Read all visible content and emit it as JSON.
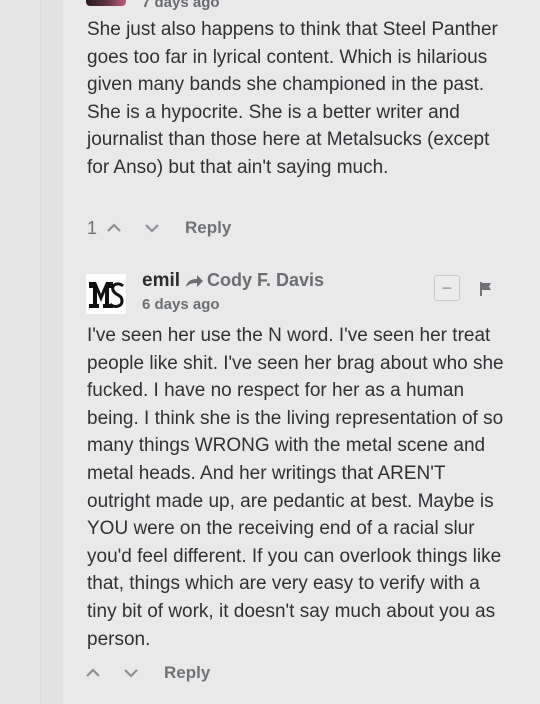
{
  "parent_comment": {
    "timestamp": "7 days ago",
    "text": "She just also happens to think that Steel Panther goes too far in lyrical content. Which is hilarious given many bands she championed in the past. She is a hypocrite. She is a better writer and journalist than those here at Metalsucks (except for Anso) but that ain't saying much.",
    "upvotes": "1",
    "reply_label": "Reply"
  },
  "reply_comment": {
    "author": "emil",
    "reply_to": "Cody F. Davis",
    "timestamp": "6 days ago",
    "collapse_label": "−",
    "text": "I've seen her use the N word. I've seen her treat people like shit. I've seen her brag about who she fucked. I have no respect for her as a human being. I think she is the living representation of so many things WRONG with the metal scene and metal heads. And her writings that AREN'T outright made up, are pedantic at best. Maybe is YOU were on the receiving end of a racial slur you'd feel different. If you can overlook things like that, things which are very easy to verify with a tiny bit of work, it doesn't say much about you as person.",
    "upvotes": "",
    "reply_label": "Reply"
  },
  "icons": {
    "upvote": "chevron-up-icon",
    "downvote": "chevron-down-icon",
    "reply_arrow": "share-arrow-icon",
    "flag": "flag-icon"
  },
  "colors": {
    "background": "#e9e9e9",
    "text": "#2f3235",
    "muted": "#6f7377"
  }
}
